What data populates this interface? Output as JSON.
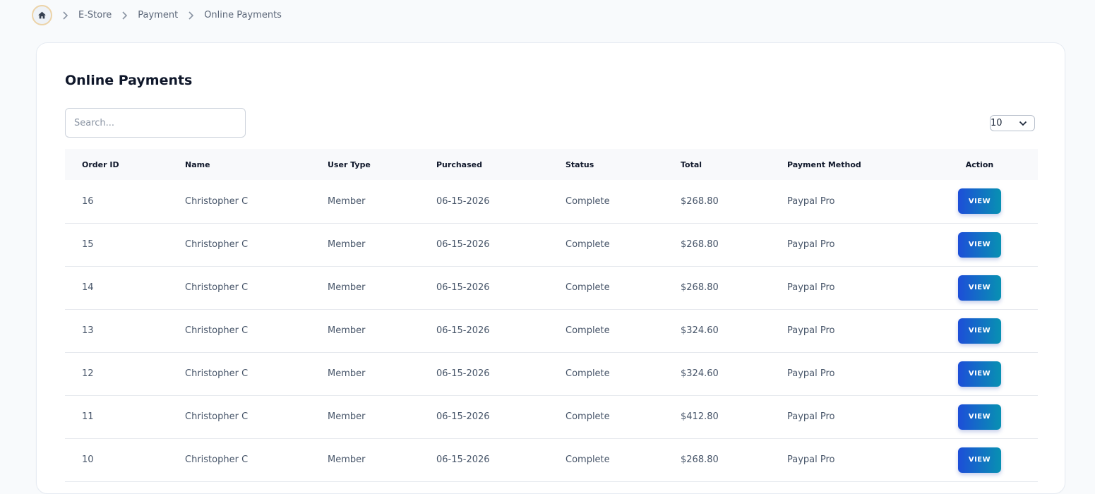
{
  "breadcrumb": {
    "items": [
      "E-Store",
      "Payment",
      "Online Payments"
    ]
  },
  "page": {
    "title": "Online Payments",
    "search_placeholder": "Search...",
    "per_page": "10"
  },
  "table": {
    "headers": [
      "Order ID",
      "Name",
      "User Type",
      "Purchased",
      "Status",
      "Total",
      "Payment Method",
      "Action"
    ],
    "action_label": "VIEW",
    "rows": [
      {
        "order_id": "16",
        "name": "Christopher C",
        "user_type": "Member",
        "purchased": "06-15-2026",
        "status": "Complete",
        "total": "$268.80",
        "method": "Paypal Pro"
      },
      {
        "order_id": "15",
        "name": "Christopher C",
        "user_type": "Member",
        "purchased": "06-15-2026",
        "status": "Complete",
        "total": "$268.80",
        "method": "Paypal Pro"
      },
      {
        "order_id": "14",
        "name": "Christopher C",
        "user_type": "Member",
        "purchased": "06-15-2026",
        "status": "Complete",
        "total": "$268.80",
        "method": "Paypal Pro"
      },
      {
        "order_id": "13",
        "name": "Christopher C",
        "user_type": "Member",
        "purchased": "06-15-2026",
        "status": "Complete",
        "total": "$324.60",
        "method": "Paypal Pro"
      },
      {
        "order_id": "12",
        "name": "Christopher C",
        "user_type": "Member",
        "purchased": "06-15-2026",
        "status": "Complete",
        "total": "$324.60",
        "method": "Paypal Pro"
      },
      {
        "order_id": "11",
        "name": "Christopher C",
        "user_type": "Member",
        "purchased": "06-15-2026",
        "status": "Complete",
        "total": "$412.80",
        "method": "Paypal Pro"
      },
      {
        "order_id": "10",
        "name": "Christopher C",
        "user_type": "Member",
        "purchased": "06-15-2026",
        "status": "Complete",
        "total": "$268.80",
        "method": "Paypal Pro"
      }
    ]
  },
  "colors": {
    "accent_start": "#1d4ed8",
    "accent_end": "#0891b2",
    "home_ring": "#ecd3a8"
  },
  "icons": {
    "home": "home-icon",
    "separator": "chevron-right-icon",
    "dropdown": "chevron-down-icon"
  }
}
